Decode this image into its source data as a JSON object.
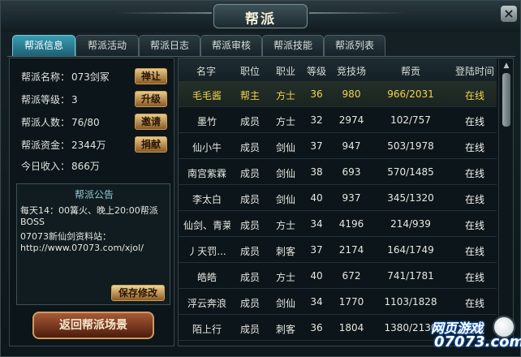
{
  "window": {
    "title": "帮派"
  },
  "tabs": [
    {
      "label": "帮派信息"
    },
    {
      "label": "帮派活动"
    },
    {
      "label": "帮派日志"
    },
    {
      "label": "帮派审核"
    },
    {
      "label": "帮派技能"
    },
    {
      "label": "帮派列表"
    }
  ],
  "guild_info": {
    "name": {
      "label": "帮派名称：",
      "value": "073剑冢",
      "button": "禅让"
    },
    "level": {
      "label": "帮派等级：",
      "value": "3",
      "button": "升级"
    },
    "members": {
      "label": "帮派人数：",
      "value": "76/80",
      "button": "邀请"
    },
    "funds": {
      "label": "帮派资金：",
      "value": "2344万",
      "button": "捐献"
    },
    "income": {
      "label": "今日收入：",
      "value": "866万"
    }
  },
  "notice": {
    "title": "帮派公告",
    "lines": [
      "每天14：00篝火、晚上20:00帮派",
      "BOSS",
      "07073新仙剑资料站：",
      "http://www.07073.com/xjol/"
    ],
    "save_label": "保存修改"
  },
  "return_button": "返回帮派场景",
  "table": {
    "headers": [
      "名字",
      "职位",
      "职业",
      "等级",
      "竞技场",
      "帮贡",
      "登陆时间"
    ],
    "rows": [
      [
        "毛毛酱",
        "帮主",
        "方士",
        "36",
        "980",
        "966/2031",
        "在线"
      ],
      [
        "墨竹",
        "成员",
        "方士",
        "32",
        "2974",
        "102/757",
        "在线"
      ],
      [
        "仙小牛",
        "成员",
        "剑仙",
        "37",
        "947",
        "503/1978",
        "在线"
      ],
      [
        "南宫紫霖",
        "成员",
        "剑仙",
        "38",
        "693",
        "570/1485",
        "在线"
      ],
      [
        "李太白",
        "成员",
        "剑仙",
        "40",
        "937",
        "345/1320",
        "在线"
      ],
      [
        "仙剑、青莱",
        "成员",
        "方士",
        "34",
        "4196",
        "214/939",
        "在线"
      ],
      [
        "丿天罚...",
        "成员",
        "刺客",
        "37",
        "2174",
        "164/1749",
        "在线"
      ],
      [
        "皓皓",
        "成员",
        "方士",
        "40",
        "672",
        "741/1781",
        "在线"
      ],
      [
        "浮云奔浪",
        "成员",
        "剑仙",
        "34",
        "1770",
        "1103/1828",
        "在线"
      ],
      [
        "陌上行",
        "成员",
        "刺客",
        "36",
        "1804",
        "1380/2130",
        "在线"
      ]
    ]
  },
  "watermark": {
    "top": "网页游戏",
    "bottom": "07073.com"
  }
}
